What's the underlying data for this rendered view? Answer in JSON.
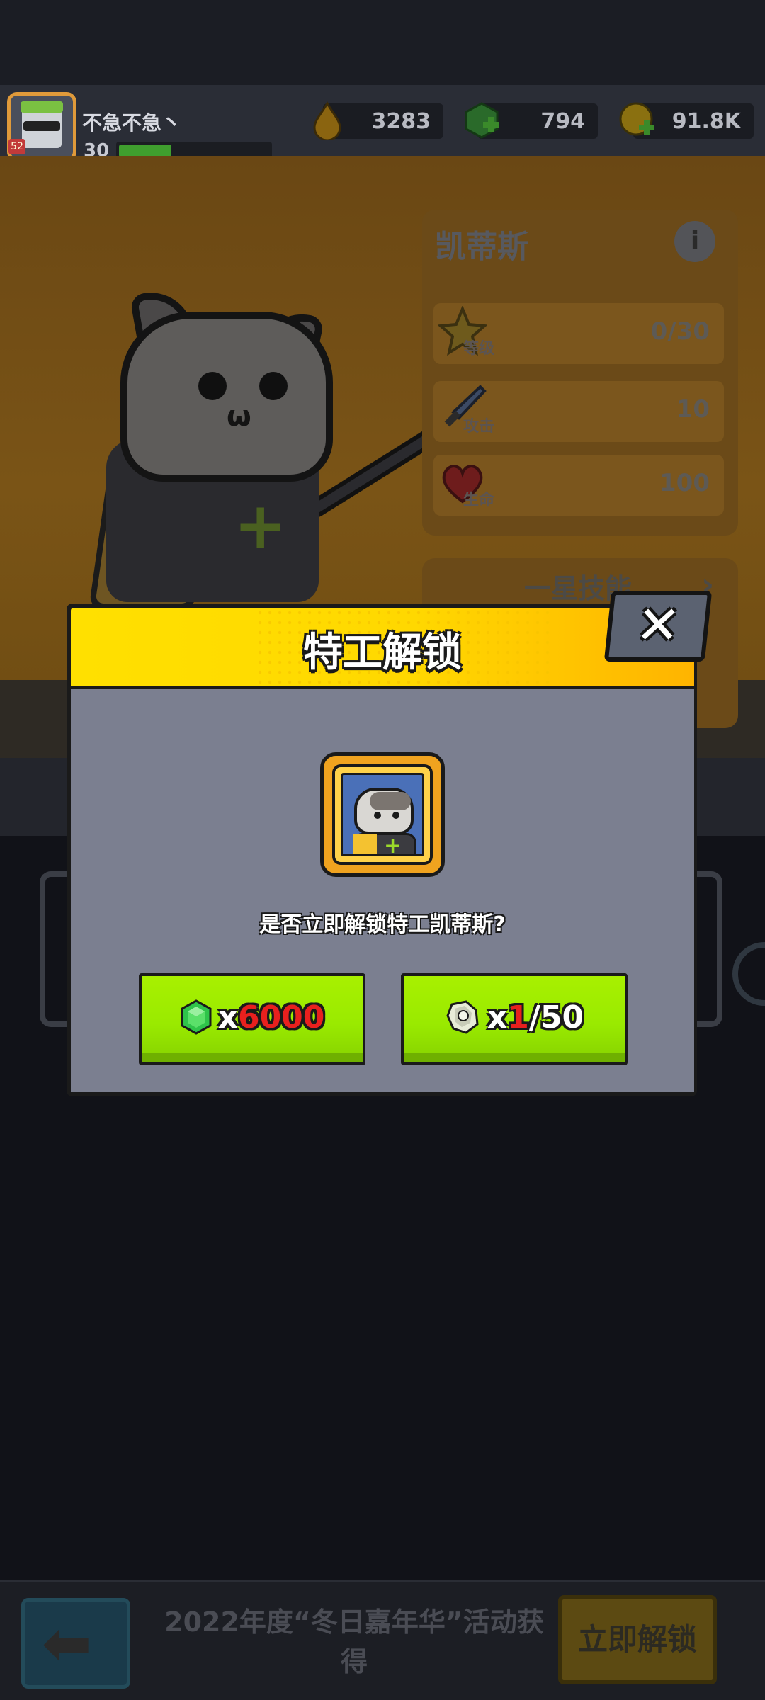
{
  "colors": {
    "header_yellow": "#ffe000",
    "button_green": "#9aea00",
    "modal_body": "#7b7f90",
    "frame_gold": "#f0a31f",
    "cost_red": "#e8201e"
  },
  "player": {
    "name": "不急不急丶",
    "level": "30",
    "xp_fraction": 0.35,
    "avatar_tag": "52",
    "avatar_icon": "player-avatar-icon"
  },
  "currencies": [
    {
      "icon": "energy-drop-icon",
      "value": "3283",
      "color": "#e8a818"
    },
    {
      "icon": "gem-plus-icon",
      "value": "794",
      "color": "#3cb43c"
    },
    {
      "icon": "coin-plus-icon",
      "value": "91.8K",
      "color": "#e8c818"
    }
  ],
  "hero_panel": {
    "name": "凯蒂斯",
    "info_icon": "info-icon",
    "stats": [
      {
        "label": "等级",
        "value": "0/30",
        "icon": "star-level-icon"
      },
      {
        "label": "攻击",
        "value": "10",
        "icon": "sword-attack-icon"
      },
      {
        "label": "生命",
        "value": "100",
        "icon": "heart-hp-icon"
      }
    ],
    "skill_label": "一星技能"
  },
  "modal": {
    "title": "特工解锁",
    "close_icon": "close-icon",
    "portrait_icon": "agent-cat-portrait-icon",
    "prompt": "是否立即解锁特工凯蒂斯?",
    "gem_button": {
      "icon": "gem-icon",
      "prefix": "x",
      "amount": "6000"
    },
    "shard_button": {
      "icon": "shard-icon",
      "prefix": "x",
      "owned": "1",
      "required": "/50"
    }
  },
  "bottom_bar": {
    "back_icon": "back-arrow-icon",
    "event_text": "2022年度“冬日嘉年华”活动获得",
    "unlock_label": "立即解锁"
  }
}
